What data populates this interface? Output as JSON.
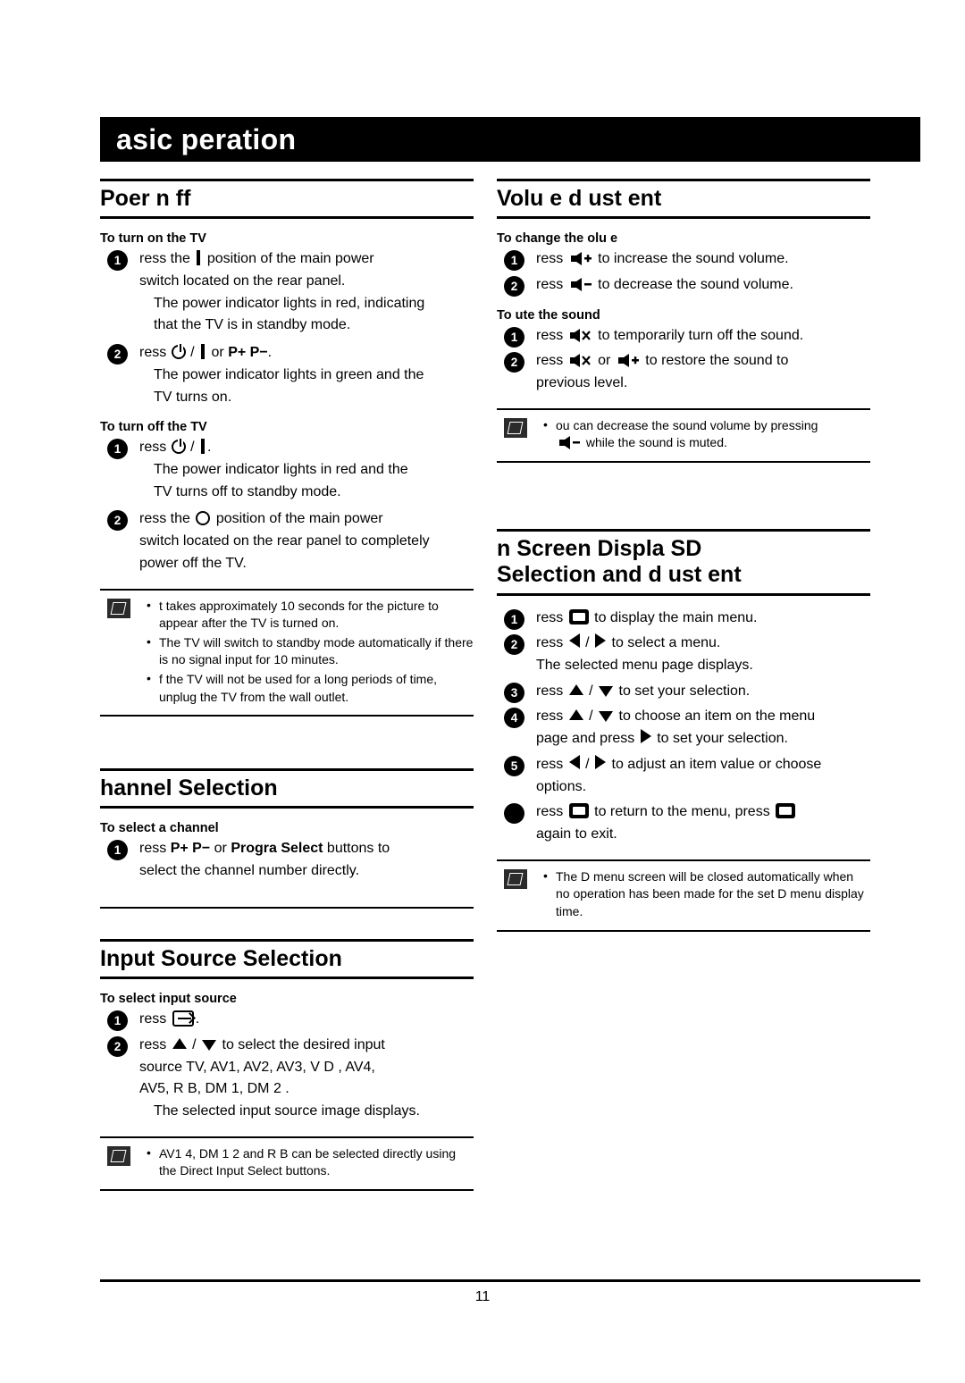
{
  "header": {
    "title": "asic  peration"
  },
  "page_number": "11",
  "left": {
    "power": {
      "title": "Poer  n  ff",
      "sub_on": "To turn on the TV",
      "s1_a": "ress the",
      "s1_b": "position of the main power",
      "s1_cont": "switch located on the rear panel.",
      "s1_cont2_l1": "The power indicator lights in red, indicating",
      "s1_cont2_l2": "that the TV is in standby mode.",
      "s2_a": "ress",
      "s2_or": "or",
      "s2_keys": "P+ P−",
      "s2_end": ".",
      "s2_cont_l1": "The power indicator lights in green and the",
      "s2_cont_l2": "TV turns on.",
      "sub_off": "To turn off the TV",
      "o1_a": "ress",
      "o1_cont_l1": "The power indicator lights in red and the",
      "o1_cont_l2": "TV turns off to standby mode.",
      "o2_a": "ress the",
      "o2_b": "position of the main power",
      "o2_cont_l1": "switch located on the rear panel to completely",
      "o2_cont_l2": "power off the TV.",
      "notes": [
        "t takes approximately 10 seconds for the picture to appear after the TV is turned on.",
        "The TV will switch to standby mode automatically if there is no signal input for 10 minutes.",
        "f the TV will not be used for a long periods of time, unplug the TV from the wall outlet."
      ]
    },
    "channel": {
      "title": "hannel Selection",
      "sub": "To select a channel",
      "s1_a": "ress",
      "s1_keys1": "P+ P−",
      "s1_mid": "or",
      "s1_keys2": "Progra  Select",
      "s1_end": "buttons to",
      "s1_cont": "select the channel number directly."
    },
    "input": {
      "title": "Input Source Selection",
      "sub": "To select input source",
      "s1_a": "ress",
      "s1_end": ".",
      "s2_a": "ress",
      "s2_mid": "/",
      "s2_b": "to select the desired input",
      "s2_cont_l1": "source  TV, AV1, AV2, AV3,  V D , AV4,",
      "s2_cont_l2": "AV5, R B,  DM 1,  DM 2 .",
      "s2_cont_l3": "The selected input source image displays.",
      "notes": [
        "AV1 4,  DM 1 2 and R B can be selected directly using the Direct Input Select buttons."
      ],
      "note_bold": "Direct Input Select"
    }
  },
  "right": {
    "volume": {
      "title": "Volu e  d ust ent",
      "sub_change": "To change the  olu e",
      "c1_a": "ress",
      "c1_b": "to increase the sound volume.",
      "c2_a": "ress",
      "c2_b": "to decrease the sound volume.",
      "sub_mute": "To  ute the sound",
      "m1_a": "ress",
      "m1_b": "to temporarily turn off the sound.",
      "m2_a": "ress",
      "m2_or": "or",
      "m2_b": "to restore the sound to",
      "m2_cont": "previous level.",
      "notes": [
        "ou can decrease the sound volume by pressing"
      ],
      "note_tail": "while the sound is muted."
    },
    "osd": {
      "title_l1": "n Screen Displa   SD",
      "title_l2": "Selection and  d ust ent",
      "s1_a": "ress",
      "s1_b": "to display the main menu.",
      "s2_a": "ress",
      "s2_mid": "/",
      "s2_b": "to select a menu.",
      "s2_cont": "The selected menu page displays.",
      "s3_a": "ress",
      "s3_mid": "/",
      "s3_b": "to set your selection.",
      "s4_a": "ress",
      "s4_mid": "/",
      "s4_b": "to choose an item on the menu",
      "s4_cont_a": "page and press",
      "s4_cont_b": "to set your selection.",
      "s5_a": "ress",
      "s5_mid": "/",
      "s5_b": "to adjust an item value or choose",
      "s5_cont": "options.",
      "s6_a": "ress",
      "s6_b": "to return to the menu, press",
      "s6_cont": "again to exit.",
      "notes": [
        "The  D menu screen will be closed automatically when no operation has been made for the set  D menu display time."
      ]
    }
  }
}
